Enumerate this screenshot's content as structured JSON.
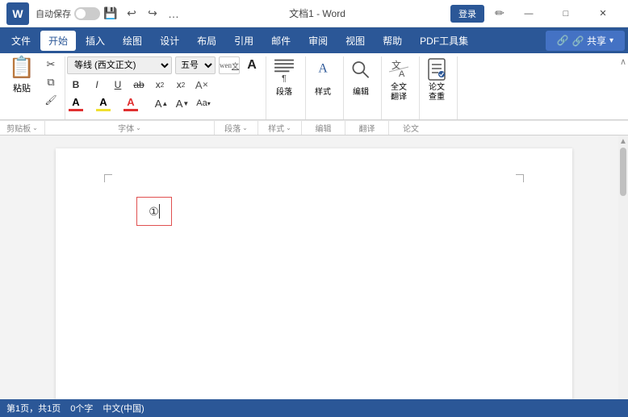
{
  "titlebar": {
    "logo": "W",
    "autosave_label": "自动保存",
    "toggle_state": "off",
    "save_icon": "💾",
    "undo_icon": "↩",
    "redo_icon": "↪",
    "more_icon": "…",
    "title": "文档1 - Word",
    "login_label": "登录",
    "pen_icon": "✏",
    "minimize_label": "—",
    "maximize_label": "□",
    "close_label": "✕"
  },
  "menubar": {
    "items": [
      "文件",
      "开始",
      "插入",
      "绘图",
      "设计",
      "布局",
      "引用",
      "邮件",
      "审阅",
      "视图",
      "帮助",
      "PDF工具集"
    ],
    "active_index": 1,
    "share_label": "🔗 共享"
  },
  "ribbon": {
    "clipboard_group": {
      "label": "剪贴板",
      "paste_label": "粘贴",
      "icons": [
        "✂",
        "📋",
        "✏"
      ]
    },
    "font_group": {
      "label": "字体",
      "font_name": "等线 (西文正文)",
      "font_size": "五号",
      "wen_label": "wen文",
      "A_label": "A",
      "bold": "B",
      "italic": "I",
      "underline": "U",
      "strikethrough": "ab",
      "subscript": "x₂",
      "superscript": "x²",
      "clear_format": "A",
      "font_color_label": "A",
      "highlight_label": "A",
      "font_color2_label": "A",
      "size_up": "A↑",
      "size_down": "A↓",
      "aa_label": "Aa",
      "expand_icon": "⌄"
    },
    "paragraph_group": {
      "label": "段落",
      "icon": "¶"
    },
    "style_group": {
      "label": "样式",
      "items": [
        "样式"
      ]
    },
    "edit_group": {
      "label": "编辑",
      "icon": "🔍"
    },
    "translate_group": {
      "label": "翻译",
      "full_translate_label": "全文\n翻译",
      "paper_translate_label": "论文\n查重"
    },
    "article_group": {
      "label": "论文"
    },
    "collapse_label": "∧"
  },
  "document": {
    "cursor_char": "①",
    "page_bg": "#ffffff"
  },
  "statusbar": {
    "page_info": "第1页，共1页",
    "word_count": "0个字",
    "lang": "中文(中国)"
  }
}
